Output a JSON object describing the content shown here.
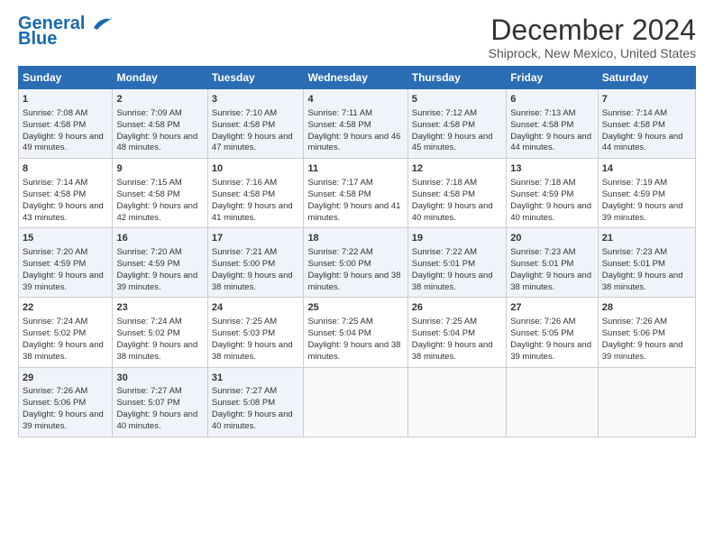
{
  "logo": {
    "line1": "General",
    "line2": "Blue"
  },
  "title": "December 2024",
  "subtitle": "Shiprock, New Mexico, United States",
  "days_of_week": [
    "Sunday",
    "Monday",
    "Tuesday",
    "Wednesday",
    "Thursday",
    "Friday",
    "Saturday"
  ],
  "weeks": [
    [
      {
        "day": 1,
        "sunrise": "7:08 AM",
        "sunset": "4:58 PM",
        "daylight": "9 hours and 49 minutes."
      },
      {
        "day": 2,
        "sunrise": "7:09 AM",
        "sunset": "4:58 PM",
        "daylight": "9 hours and 48 minutes."
      },
      {
        "day": 3,
        "sunrise": "7:10 AM",
        "sunset": "4:58 PM",
        "daylight": "9 hours and 47 minutes."
      },
      {
        "day": 4,
        "sunrise": "7:11 AM",
        "sunset": "4:58 PM",
        "daylight": "9 hours and 46 minutes."
      },
      {
        "day": 5,
        "sunrise": "7:12 AM",
        "sunset": "4:58 PM",
        "daylight": "9 hours and 45 minutes."
      },
      {
        "day": 6,
        "sunrise": "7:13 AM",
        "sunset": "4:58 PM",
        "daylight": "9 hours and 44 minutes."
      },
      {
        "day": 7,
        "sunrise": "7:14 AM",
        "sunset": "4:58 PM",
        "daylight": "9 hours and 44 minutes."
      }
    ],
    [
      {
        "day": 8,
        "sunrise": "7:14 AM",
        "sunset": "4:58 PM",
        "daylight": "9 hours and 43 minutes."
      },
      {
        "day": 9,
        "sunrise": "7:15 AM",
        "sunset": "4:58 PM",
        "daylight": "9 hours and 42 minutes."
      },
      {
        "day": 10,
        "sunrise": "7:16 AM",
        "sunset": "4:58 PM",
        "daylight": "9 hours and 41 minutes."
      },
      {
        "day": 11,
        "sunrise": "7:17 AM",
        "sunset": "4:58 PM",
        "daylight": "9 hours and 41 minutes."
      },
      {
        "day": 12,
        "sunrise": "7:18 AM",
        "sunset": "4:58 PM",
        "daylight": "9 hours and 40 minutes."
      },
      {
        "day": 13,
        "sunrise": "7:18 AM",
        "sunset": "4:59 PM",
        "daylight": "9 hours and 40 minutes."
      },
      {
        "day": 14,
        "sunrise": "7:19 AM",
        "sunset": "4:59 PM",
        "daylight": "9 hours and 39 minutes."
      }
    ],
    [
      {
        "day": 15,
        "sunrise": "7:20 AM",
        "sunset": "4:59 PM",
        "daylight": "9 hours and 39 minutes."
      },
      {
        "day": 16,
        "sunrise": "7:20 AM",
        "sunset": "4:59 PM",
        "daylight": "9 hours and 39 minutes."
      },
      {
        "day": 17,
        "sunrise": "7:21 AM",
        "sunset": "5:00 PM",
        "daylight": "9 hours and 38 minutes."
      },
      {
        "day": 18,
        "sunrise": "7:22 AM",
        "sunset": "5:00 PM",
        "daylight": "9 hours and 38 minutes."
      },
      {
        "day": 19,
        "sunrise": "7:22 AM",
        "sunset": "5:01 PM",
        "daylight": "9 hours and 38 minutes."
      },
      {
        "day": 20,
        "sunrise": "7:23 AM",
        "sunset": "5:01 PM",
        "daylight": "9 hours and 38 minutes."
      },
      {
        "day": 21,
        "sunrise": "7:23 AM",
        "sunset": "5:01 PM",
        "daylight": "9 hours and 38 minutes."
      }
    ],
    [
      {
        "day": 22,
        "sunrise": "7:24 AM",
        "sunset": "5:02 PM",
        "daylight": "9 hours and 38 minutes."
      },
      {
        "day": 23,
        "sunrise": "7:24 AM",
        "sunset": "5:02 PM",
        "daylight": "9 hours and 38 minutes."
      },
      {
        "day": 24,
        "sunrise": "7:25 AM",
        "sunset": "5:03 PM",
        "daylight": "9 hours and 38 minutes."
      },
      {
        "day": 25,
        "sunrise": "7:25 AM",
        "sunset": "5:04 PM",
        "daylight": "9 hours and 38 minutes."
      },
      {
        "day": 26,
        "sunrise": "7:25 AM",
        "sunset": "5:04 PM",
        "daylight": "9 hours and 38 minutes."
      },
      {
        "day": 27,
        "sunrise": "7:26 AM",
        "sunset": "5:05 PM",
        "daylight": "9 hours and 39 minutes."
      },
      {
        "day": 28,
        "sunrise": "7:26 AM",
        "sunset": "5:06 PM",
        "daylight": "9 hours and 39 minutes."
      }
    ],
    [
      {
        "day": 29,
        "sunrise": "7:26 AM",
        "sunset": "5:06 PM",
        "daylight": "9 hours and 39 minutes."
      },
      {
        "day": 30,
        "sunrise": "7:27 AM",
        "sunset": "5:07 PM",
        "daylight": "9 hours and 40 minutes."
      },
      {
        "day": 31,
        "sunrise": "7:27 AM",
        "sunset": "5:08 PM",
        "daylight": "9 hours and 40 minutes."
      },
      null,
      null,
      null,
      null
    ]
  ]
}
